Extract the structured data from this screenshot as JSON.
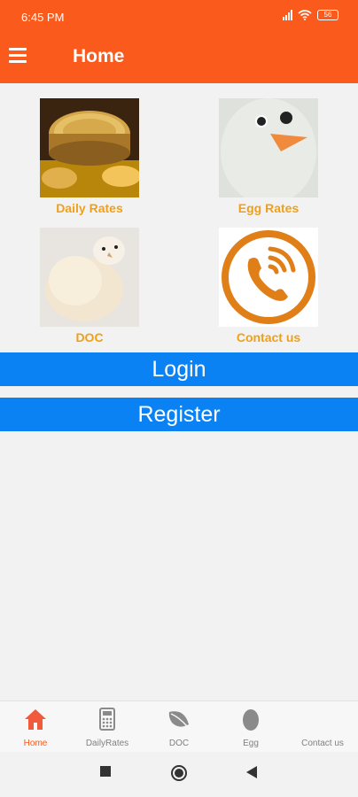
{
  "status_bar": {
    "time": "6:45 PM",
    "battery": "56",
    "icons": [
      "signal-icon",
      "wifi-icon",
      "battery-icon"
    ]
  },
  "app_bar": {
    "title": "Home",
    "menu_icon": "menu-icon",
    "color": "#fa5a1c"
  },
  "tiles": [
    {
      "label": "Daily Rates",
      "icon": "coins-image"
    },
    {
      "label": "Egg Rates",
      "icon": "egg-face-image"
    },
    {
      "label": "DOC",
      "icon": "chick-image"
    },
    {
      "label": "Contact us",
      "icon": "phone-circle-icon"
    }
  ],
  "buttons": {
    "login": "Login",
    "register": "Register",
    "color": "#0b82f4"
  },
  "bottom_nav": {
    "items": [
      {
        "label": "Home",
        "icon": "home-icon",
        "active": true
      },
      {
        "label": "DailyRates",
        "icon": "calculator-icon",
        "active": false
      },
      {
        "label": "DOC",
        "icon": "leaf-icon",
        "active": false
      },
      {
        "label": "Egg",
        "icon": "egg-icon",
        "active": false
      },
      {
        "label": "Contact us",
        "icon": "contact-icon",
        "active": false
      }
    ]
  },
  "colors": {
    "primary": "#fa5a1c",
    "tile_label": "#f0a018",
    "background": "#f2f2f2"
  }
}
